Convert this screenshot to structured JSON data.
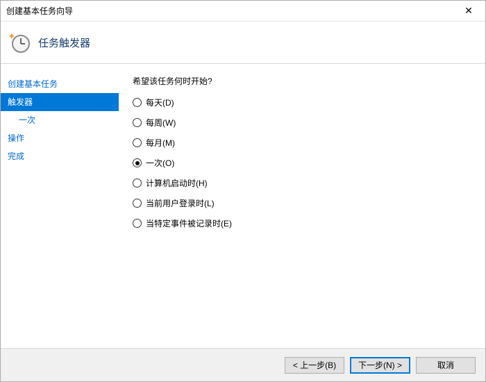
{
  "window": {
    "title": "创建基本任务向导"
  },
  "header": {
    "title": "任务触发器"
  },
  "sidebar": {
    "items": [
      {
        "label": "创建基本任务",
        "active": false,
        "sub": false
      },
      {
        "label": "触发器",
        "active": true,
        "sub": false
      },
      {
        "label": "一次",
        "active": false,
        "sub": true
      },
      {
        "label": "操作",
        "active": false,
        "sub": false
      },
      {
        "label": "完成",
        "active": false,
        "sub": false
      }
    ]
  },
  "main": {
    "prompt": "希望该任务何时开始?",
    "options": [
      {
        "label": "每天(D)",
        "checked": false
      },
      {
        "label": "每周(W)",
        "checked": false
      },
      {
        "label": "每月(M)",
        "checked": false
      },
      {
        "label": "一次(O)",
        "checked": true
      },
      {
        "label": "计算机启动时(H)",
        "checked": false
      },
      {
        "label": "当前用户登录时(L)",
        "checked": false
      },
      {
        "label": "当特定事件被记录时(E)",
        "checked": false
      }
    ]
  },
  "footer": {
    "back": "< 上一步(B)",
    "next": "下一步(N) >",
    "cancel": "取消"
  }
}
